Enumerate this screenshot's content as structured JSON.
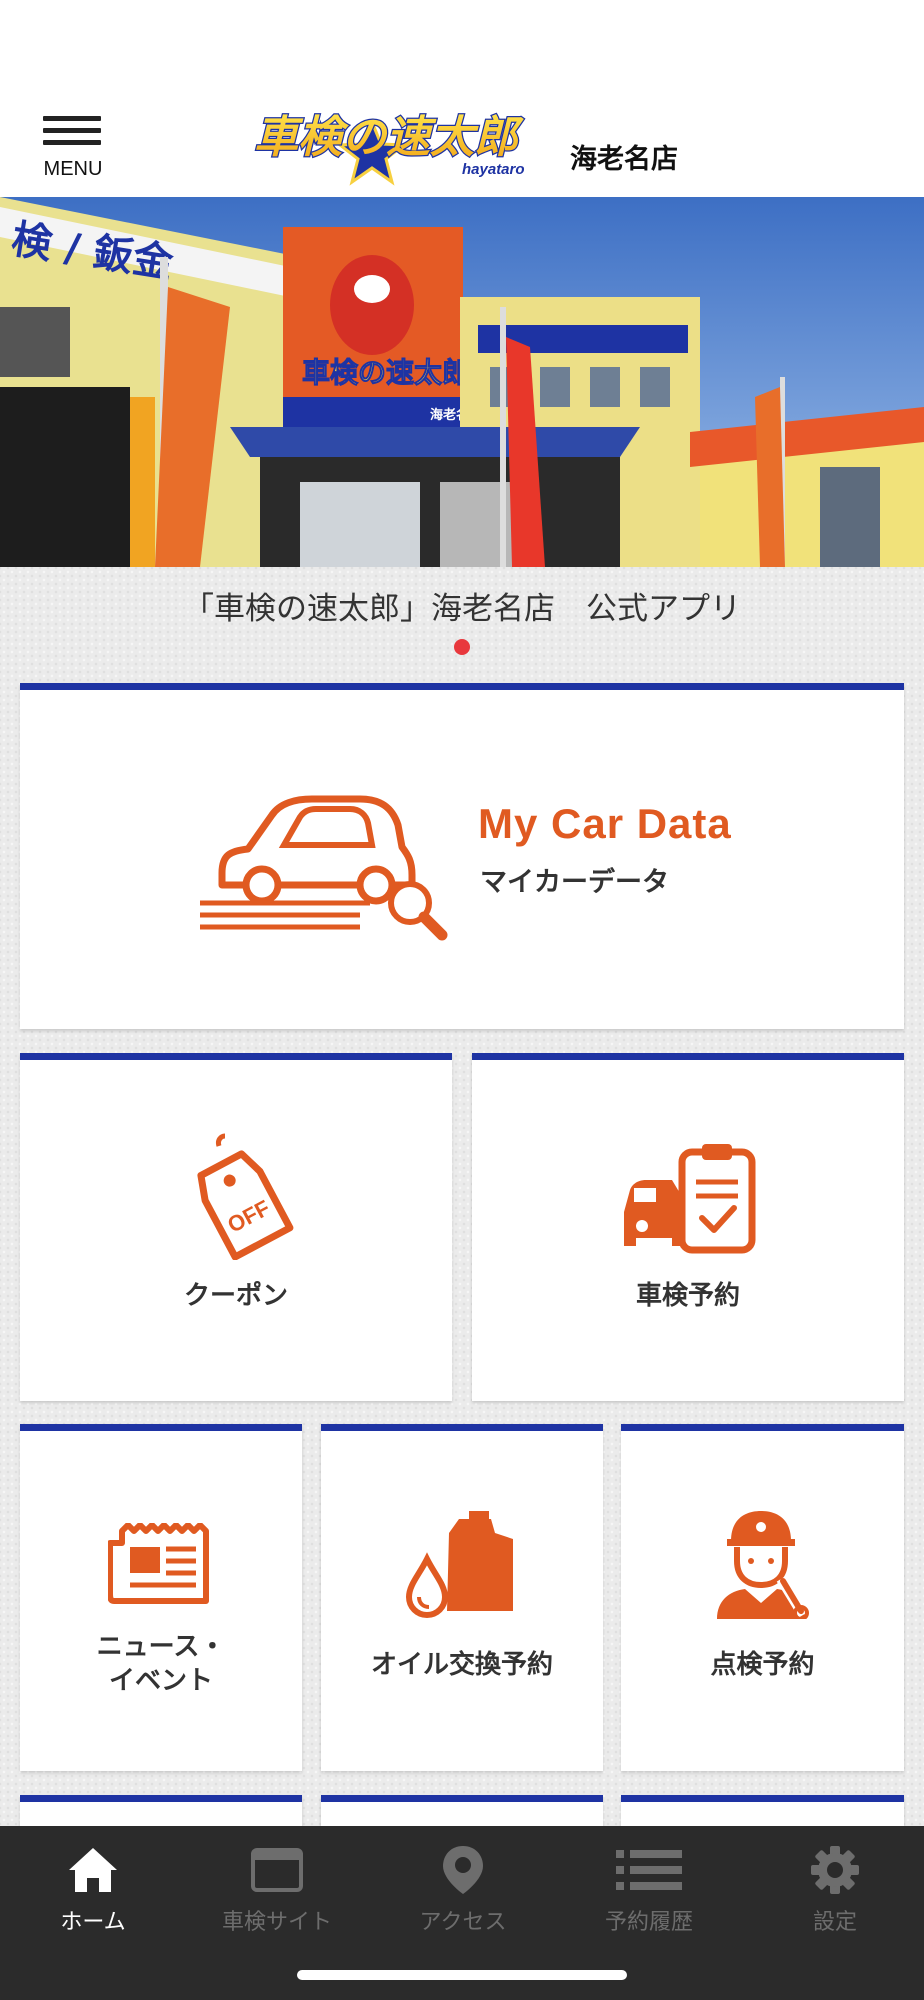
{
  "header": {
    "menu_label": "MENU",
    "brand_logo_text": "車検の速太郎",
    "brand_logo_sub": "hayataro",
    "store_name": "海老名店"
  },
  "hero": {
    "caption": "「車検の速太郎」海老名店　公式アプリ",
    "slide_count": 1,
    "active_slide": 1,
    "photo_sign_text": "検 / 鈑金",
    "photo_store_text": "海老名店"
  },
  "tiles": {
    "my_car_data": {
      "title": "My Car Data",
      "subtitle": "マイカーデータ",
      "icon": "car-search-icon"
    },
    "coupon": {
      "title": "クーポン",
      "icon": "off-tag-icon"
    },
    "shaken_booking": {
      "title": "車検予約",
      "icon": "car-clipboard-icon"
    },
    "news_line1": "ニュース・",
    "news_line2": "イベント",
    "news_icon": "newspaper-icon",
    "oil_booking": {
      "title": "オイル交換予約",
      "icon": "oil-can-icon"
    },
    "inspection_booking": {
      "title": "点検予約",
      "icon": "mechanic-icon"
    }
  },
  "tabbar": {
    "home": "ホーム",
    "shaken_site": "車検サイト",
    "access": "アクセス",
    "history": "予約履歴",
    "settings": "設定",
    "active": "home"
  },
  "colors": {
    "accent_orange": "#e05a21",
    "tile_border_blue": "#1e33a3",
    "tabbar_bg": "#2b2b2b",
    "slider_dot": "#e8383d"
  }
}
